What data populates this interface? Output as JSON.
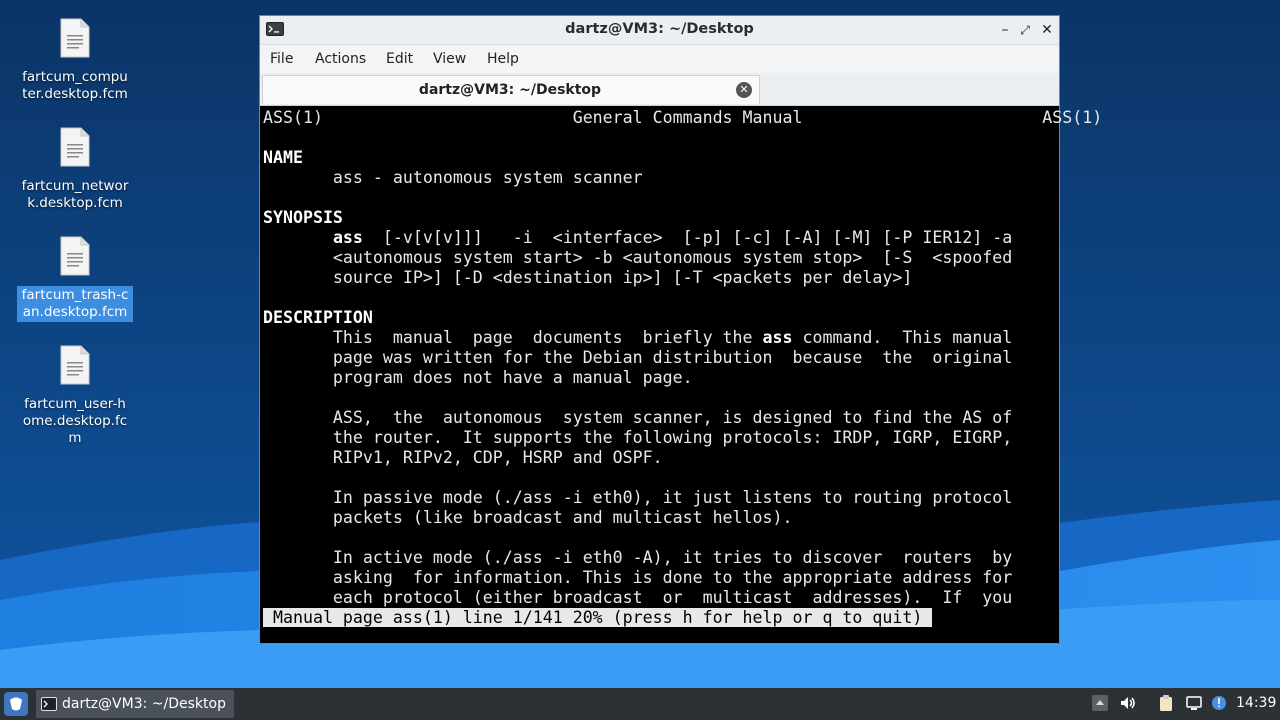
{
  "desktop": {
    "icons": [
      {
        "label": "fartcum_computer.desktop.fcm",
        "selected": false
      },
      {
        "label": "fartcum_network.desktop.fcm",
        "selected": false
      },
      {
        "label": "fartcum_trash-can.desktop.fcm",
        "selected": true
      },
      {
        "label": "fartcum_user-home.desktop.fcm",
        "selected": false
      }
    ]
  },
  "window": {
    "title": "dartz@VM3: ~/Desktop",
    "icon": "terminal-icon",
    "controls": [
      "minimize-icon",
      "maximize-icon",
      "close-icon"
    ],
    "menu": [
      "File",
      "Actions",
      "Edit",
      "View",
      "Help"
    ],
    "tab": {
      "label": "dartz@VM3: ~/Desktop"
    }
  },
  "terminal": {
    "lines": [
      [
        {
          "t": "ASS(1)                         General Commands Manual                        ASS(1)"
        }
      ],
      [
        {
          "t": ""
        }
      ],
      [
        {
          "t": "NAME",
          "b": true
        }
      ],
      [
        {
          "t": "       ass - autonomous system scanner"
        }
      ],
      [
        {
          "t": ""
        }
      ],
      [
        {
          "t": "SYNOPSIS",
          "b": true
        }
      ],
      [
        {
          "t": "       "
        },
        {
          "t": "ass",
          "b": true
        },
        {
          "t": "  [-v[v[v]]]   -i  <interface>  [-p] [-c] [-A] [-M] [-P IER12] -a"
        }
      ],
      [
        {
          "t": "       <autonomous system start> -b <autonomous system stop>  [-S  <spoofed"
        }
      ],
      [
        {
          "t": "       source IP>] [-D <destination ip>] [-T <packets per delay>]"
        }
      ],
      [
        {
          "t": ""
        }
      ],
      [
        {
          "t": "DESCRIPTION",
          "b": true
        }
      ],
      [
        {
          "t": "       This  manual  page  documents  briefly the "
        },
        {
          "t": "ass",
          "b": true
        },
        {
          "t": " command.  This manual"
        }
      ],
      [
        {
          "t": "       page was written for the Debian distribution  because  the  original"
        }
      ],
      [
        {
          "t": "       program does not have a manual page."
        }
      ],
      [
        {
          "t": ""
        }
      ],
      [
        {
          "t": "       ASS,  the  autonomous  system scanner, is designed to find the AS of"
        }
      ],
      [
        {
          "t": "       the router.  It supports the following protocols: IRDP, IGRP, EIGRP,"
        }
      ],
      [
        {
          "t": "       RIPv1, RIPv2, CDP, HSRP and OSPF."
        }
      ],
      [
        {
          "t": ""
        }
      ],
      [
        {
          "t": "       In passive mode (./ass -i eth0), it just listens to routing protocol"
        }
      ],
      [
        {
          "t": "       packets (like broadcast and multicast hellos)."
        }
      ],
      [
        {
          "t": ""
        }
      ],
      [
        {
          "t": "       In active mode (./ass -i eth0 -A), it tries to discover  routers  by"
        }
      ],
      [
        {
          "t": "       asking  for information. This is done to the appropriate address for"
        }
      ],
      [
        {
          "t": "       each protocol (either broadcast  or  multicast  addresses).  If  you"
        }
      ]
    ],
    "status": " Manual page ass(1) line 1/141 20% (press h for help or q to quit) "
  },
  "taskbar": {
    "start_icon": "start-menu-icon",
    "task": {
      "label": "dartz@VM3: ~/Desktop",
      "icon": "terminal-icon"
    },
    "tray_icons": [
      "tray-up-icon",
      "volume-icon",
      "clipboard-icon",
      "network-icon",
      "notification-icon"
    ],
    "clock": "14:39"
  }
}
